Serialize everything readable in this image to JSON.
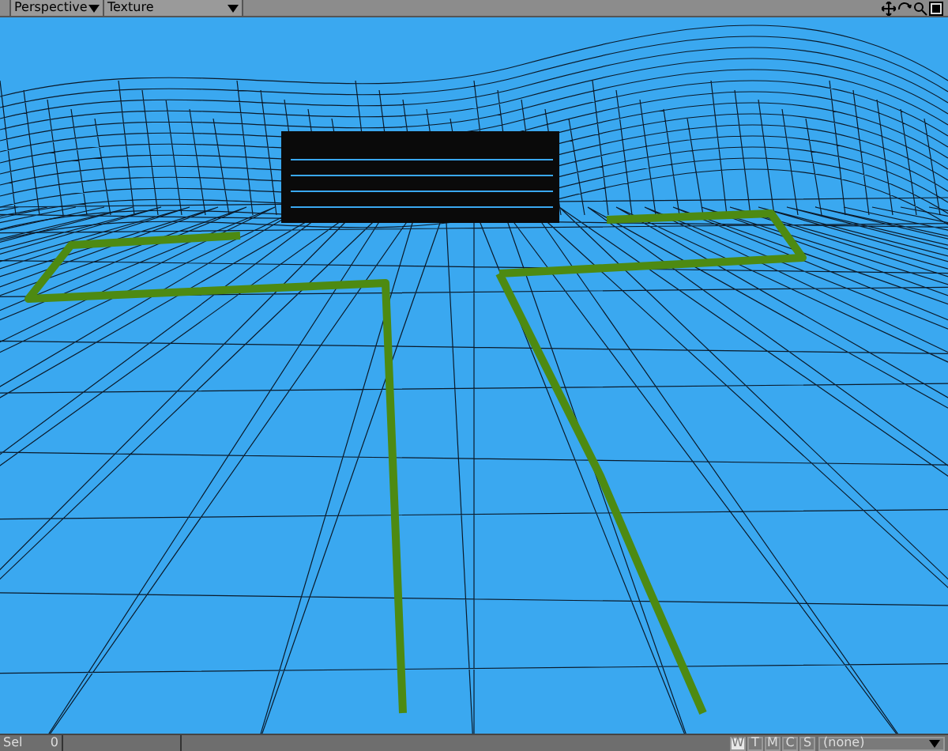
{
  "toolbar": {
    "view_mode": "Perspective",
    "shading": "Texture"
  },
  "status_bar": {
    "label": "Sel",
    "count": "0",
    "modes": [
      {
        "label": "W",
        "selected": true
      },
      {
        "label": "T",
        "selected": false
      },
      {
        "label": "M",
        "selected": false
      },
      {
        "label": "C",
        "selected": false
      },
      {
        "label": "S",
        "selected": false
      }
    ],
    "surface": "(none)"
  }
}
